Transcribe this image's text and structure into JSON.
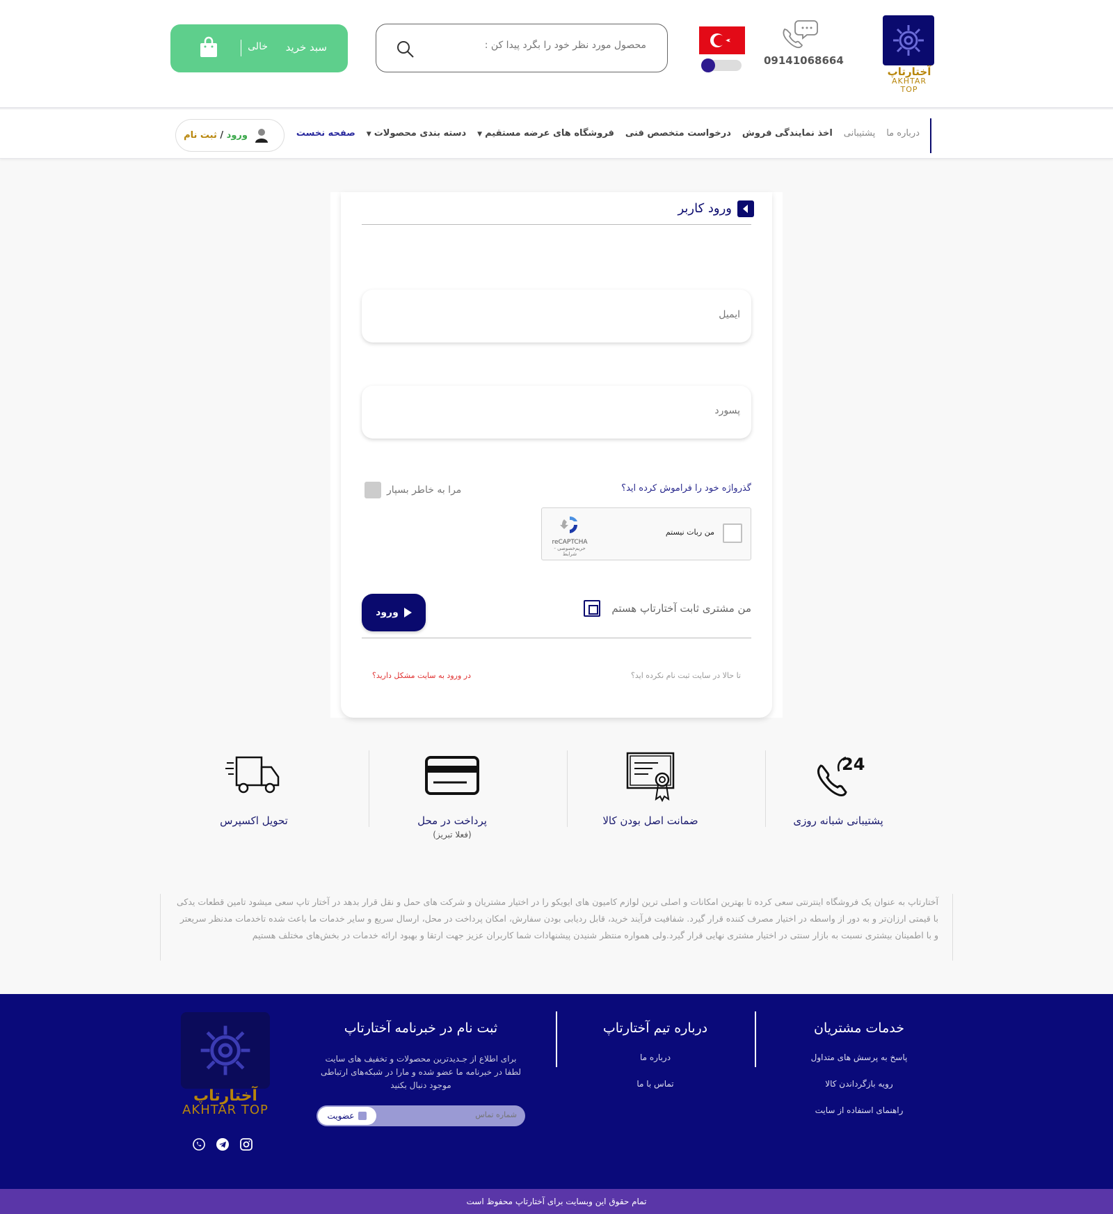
{
  "header": {
    "logo_fa": "آختارتاپ",
    "logo_en": "AKHTAR TOP",
    "phone": "09141068664",
    "search_placeholder": "محصول مورد نظر خود را بگرد پیدا کن :",
    "cart_label": "سبد خرید",
    "cart_status": "خالی"
  },
  "nav": {
    "items": [
      {
        "label": "صفحه نخست",
        "active": true
      },
      {
        "label": "دسته بندی محصولات",
        "caret": true
      },
      {
        "label": "فروشگاه های عرضه مستقیم",
        "caret": true
      },
      {
        "label": "درخواست متخصص فنی"
      },
      {
        "label": "اخذ نمایندگی فروش"
      },
      {
        "label": "پشتیبانی",
        "muted": true
      },
      {
        "label": "درباره ما",
        "muted": true
      }
    ],
    "login": "ورود",
    "slash": "/",
    "register": "ثبت نام"
  },
  "login_card": {
    "title": "ورود کاربر",
    "email_placeholder": "ایمیل",
    "password_placeholder": "پسورد",
    "forgot": "گذرواژه خود را فراموش کرده اید؟",
    "remember": "مرا به خاطر بسپار",
    "captcha_label": "من ربات نیستم",
    "captcha_brand": "reCAPTCHA",
    "captcha_sub": "حریم‌خصوصی - شرایط",
    "regular_customer": "من مشتری ثابت آختارتاپ هستم",
    "submit": "ورود",
    "not_registered": "تا حالا در سایت ثبت نام نکرده اید؟",
    "problem": "در ورود به سایت مشکل دارید؟"
  },
  "features": [
    {
      "title": "پشتیبانی شبانه روزی",
      "icon": "support-24-icon"
    },
    {
      "title": "ضمانت اصل بودن کالا",
      "icon": "certificate-icon"
    },
    {
      "title": "پرداخت در محل",
      "sub": "(فعلا تبریز)",
      "icon": "credit-card-icon"
    },
    {
      "title": "تحویل اکسپرس",
      "icon": "truck-icon"
    }
  ],
  "about": {
    "text": "آختارتاپ      به عنوان یک فروشگاه اینترنتی سعی کرده تا بهترین امکانات و اصلی ترین لوازم کامیون های ایویکو را در اختیار مشتریان و شرکت های حمل و نقل قرار بدهد در آختار تاپ سعی میشود تامین قطعات یدکی با قیمتی ارزان‌تر و به دور از واسطه در اختیار مصرف کننده قرار گیرد. شفافیت فرآیند خرید، قابل ردیابی بودن سفارش، امکان پرداخت در محل، ارسال سریع و سایر خدمات ما باعث شده تاخدمات مدنظر سریعتر و با اطمینان بیشتری نسبت به بازار سنتی در اختیار مشتری نهایی قرار گیرد.ولی همواره منتظر شنیدن پیشنهادات شما کاربران عزیز جهت ارتقا و بهبود ارائه خدمات در بخش‌های مختلف هستیم"
  },
  "footer": {
    "customer_services": {
      "title": "خدمات مشتریان",
      "links": [
        "پاسخ به پرسش های متداول",
        "رویه بازگرداندن کالا",
        "راهنمای استفاده از سایت"
      ]
    },
    "about_team": {
      "title": "درباره تیم آختارتاپ",
      "links": [
        "درباره ما",
        "تماس با ما"
      ]
    },
    "newsletter": {
      "title": "ثبت نام در خبرنامه آختارتاپ",
      "line1": "برای اطلاع از جـدیدترین محصولات و تخفیف های سایت",
      "line2": "لطفا در خبرنامه ما عضو شده و مارا در شبکه‌های ارتباطی",
      "line3": "موجود دنبال بکنید",
      "input_placeholder": "شماره تماس",
      "button": "عضویت"
    },
    "logo_fa": "آختارتاپ",
    "logo_en": "AKHTAR TOP"
  },
  "copyright": "تمام حقوق این وبسایت برای آختارتاپ محفوظ است",
  "colors": {
    "brand_navy": "#0a0a6e",
    "cart_green": "#5ecf8c",
    "copyright_purple": "#5a36a8",
    "gold": "#b8860b"
  }
}
